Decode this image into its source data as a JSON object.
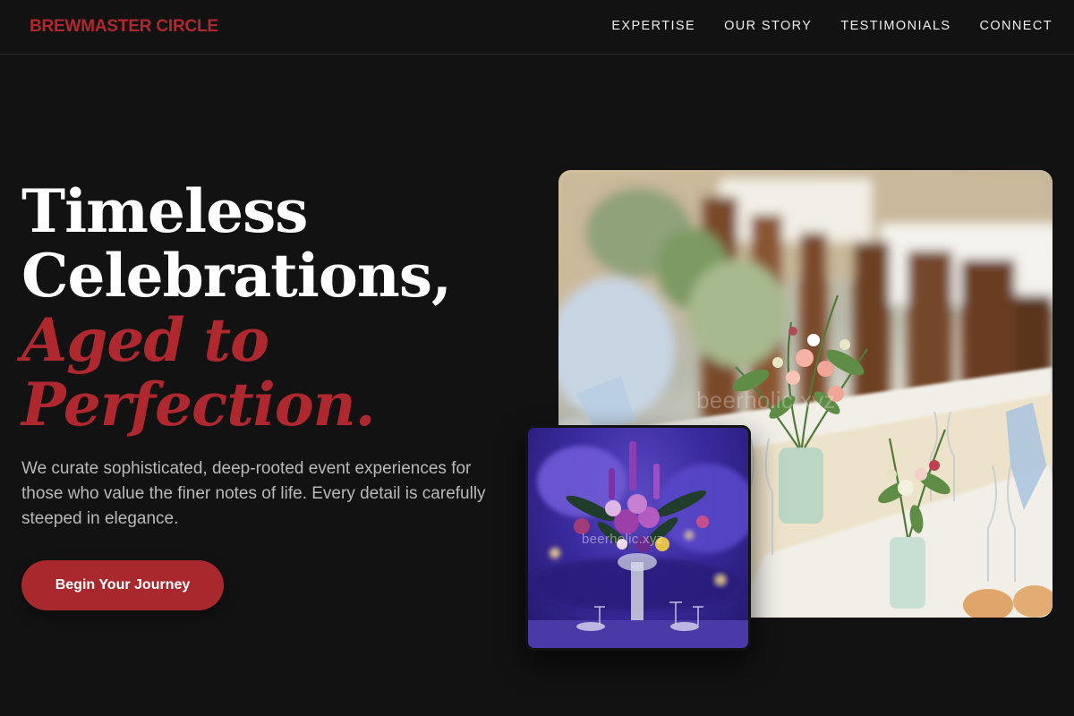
{
  "brand": {
    "name": "BREWMASTER CIRCLE"
  },
  "nav": {
    "items": [
      {
        "label": "EXPERTISE"
      },
      {
        "label": "OUR STORY"
      },
      {
        "label": "TESTIMONIALS"
      },
      {
        "label": "CONNECT"
      }
    ]
  },
  "hero": {
    "title_line1": "Timeless",
    "title_line2": "Celebrations,",
    "title_accent1": "Aged to",
    "title_accent2": "Perfection.",
    "description": "We curate sophisticated, deep-rooted event experiences for those who value the finer notes of life. Every detail is carefully steeped in elegance.",
    "cta_label": "Begin Your Journey"
  },
  "images": {
    "main_alt": "Banquet table set with floral centerpieces",
    "inset_alt": "Purple floral centerpiece under violet lighting",
    "watermark": "beerholic.xyz"
  },
  "colors": {
    "background": "#121212",
    "accent": "#b0282f",
    "button": "#a8282d",
    "text": "#ffffff",
    "muted_text": "#b9b9b9"
  }
}
